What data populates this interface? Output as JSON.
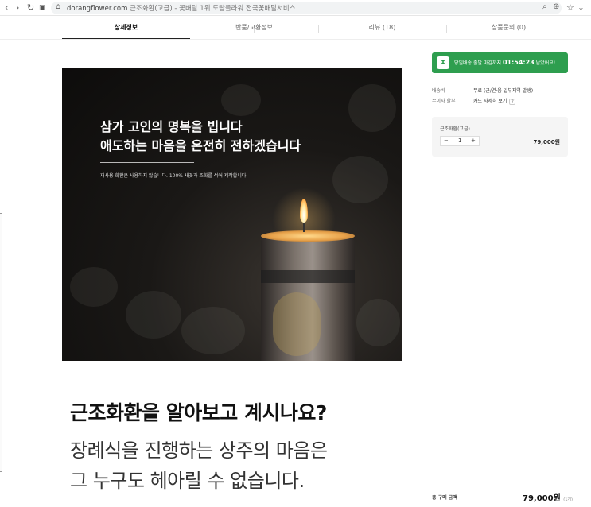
{
  "browser": {
    "url_domain": "dorangflower.com",
    "url_rest": "근조화환(고급) - 꽃배달 1위 도랑플라워 전국꽃배달서비스"
  },
  "tabs": [
    {
      "label": "상세정보",
      "active": true
    },
    {
      "label": "반품/교환정보",
      "active": false
    },
    {
      "label": "리뷰 (18)",
      "active": false
    },
    {
      "label": "상품문의 (0)",
      "active": false
    }
  ],
  "hero": {
    "title_line1": "삼가 고인의 명복을 빕니다",
    "title_line2": "애도하는 마음을 온전히 전하겠습니다",
    "subtitle": "재사용 화환은 사용하지 않습니다. 100% 새꽃과 조화를 섞어 제작합니다."
  },
  "content": {
    "heading": "근조화환을 알아보고 계시나요?",
    "body_line1": "장례식을 진행하는 상주의 마음은",
    "body_line2": "그 누구도 헤아릴 수 없습니다."
  },
  "side": {
    "badge_prefix": "당일배송 출발 마감까지",
    "badge_timer": "01:54:23",
    "badge_suffix": "남았어요!",
    "shipping_label": "배송비",
    "shipping_value": "무료 (근/연·음 일부지역 발생)",
    "interest_label": "무이자 할부",
    "interest_value": "카드 자세히 보기",
    "help_glyph": "?",
    "option_name": "근조화환(고급)",
    "qty_minus": "−",
    "qty_value": "1",
    "qty_plus": "+",
    "option_price": "79,000원",
    "total_label": "총 구매 금액",
    "total_price": "79,000원",
    "total_count": "(1개)"
  },
  "colors": {
    "badge_green": "#2e9e4f"
  }
}
